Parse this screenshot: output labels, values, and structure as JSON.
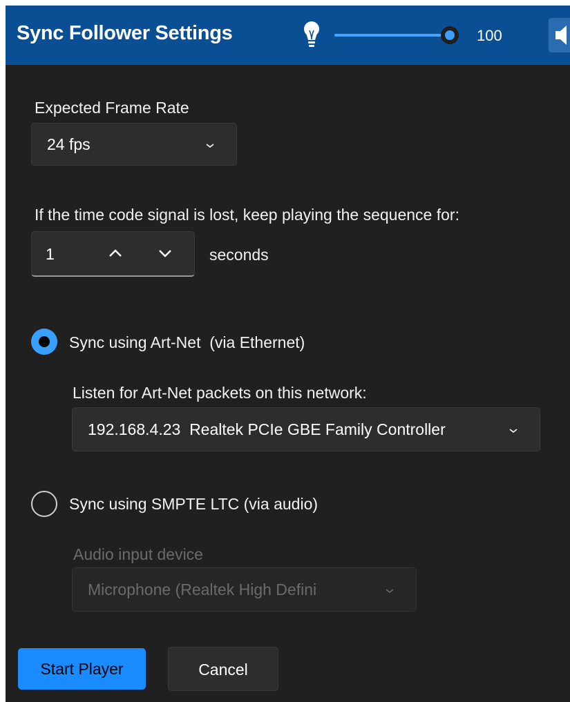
{
  "window": {
    "title": "Sync Follower Settings"
  },
  "brightness": {
    "icon": "bulb-icon",
    "value": "100",
    "level_percent": 100
  },
  "volume": {
    "icon": "speaker-icon"
  },
  "frame_rate": {
    "label": "Expected Frame Rate",
    "selected": "24 fps"
  },
  "timeout": {
    "label": "If the time code signal is lost, keep playing the sequence for:",
    "value": "1",
    "unit": "seconds"
  },
  "artnet": {
    "option_label": "Sync using Art-Net  (via Ethernet)",
    "selected": true,
    "network_label": "Listen for Art-Net packets on this network:",
    "network_selected": "192.168.4.23  Realtek PCIe GBE Family Controller"
  },
  "smpte": {
    "option_label": "Sync using SMPTE LTC (via audio)",
    "selected": false,
    "device_label": "Audio input device",
    "device_selected": "Microphone (Realtek High Defini"
  },
  "actions": {
    "start_label": "Start Player",
    "cancel_label": "Cancel"
  },
  "colors": {
    "titlebar": "#0a4f94",
    "accent": "#1a8cff",
    "background": "#202020"
  }
}
